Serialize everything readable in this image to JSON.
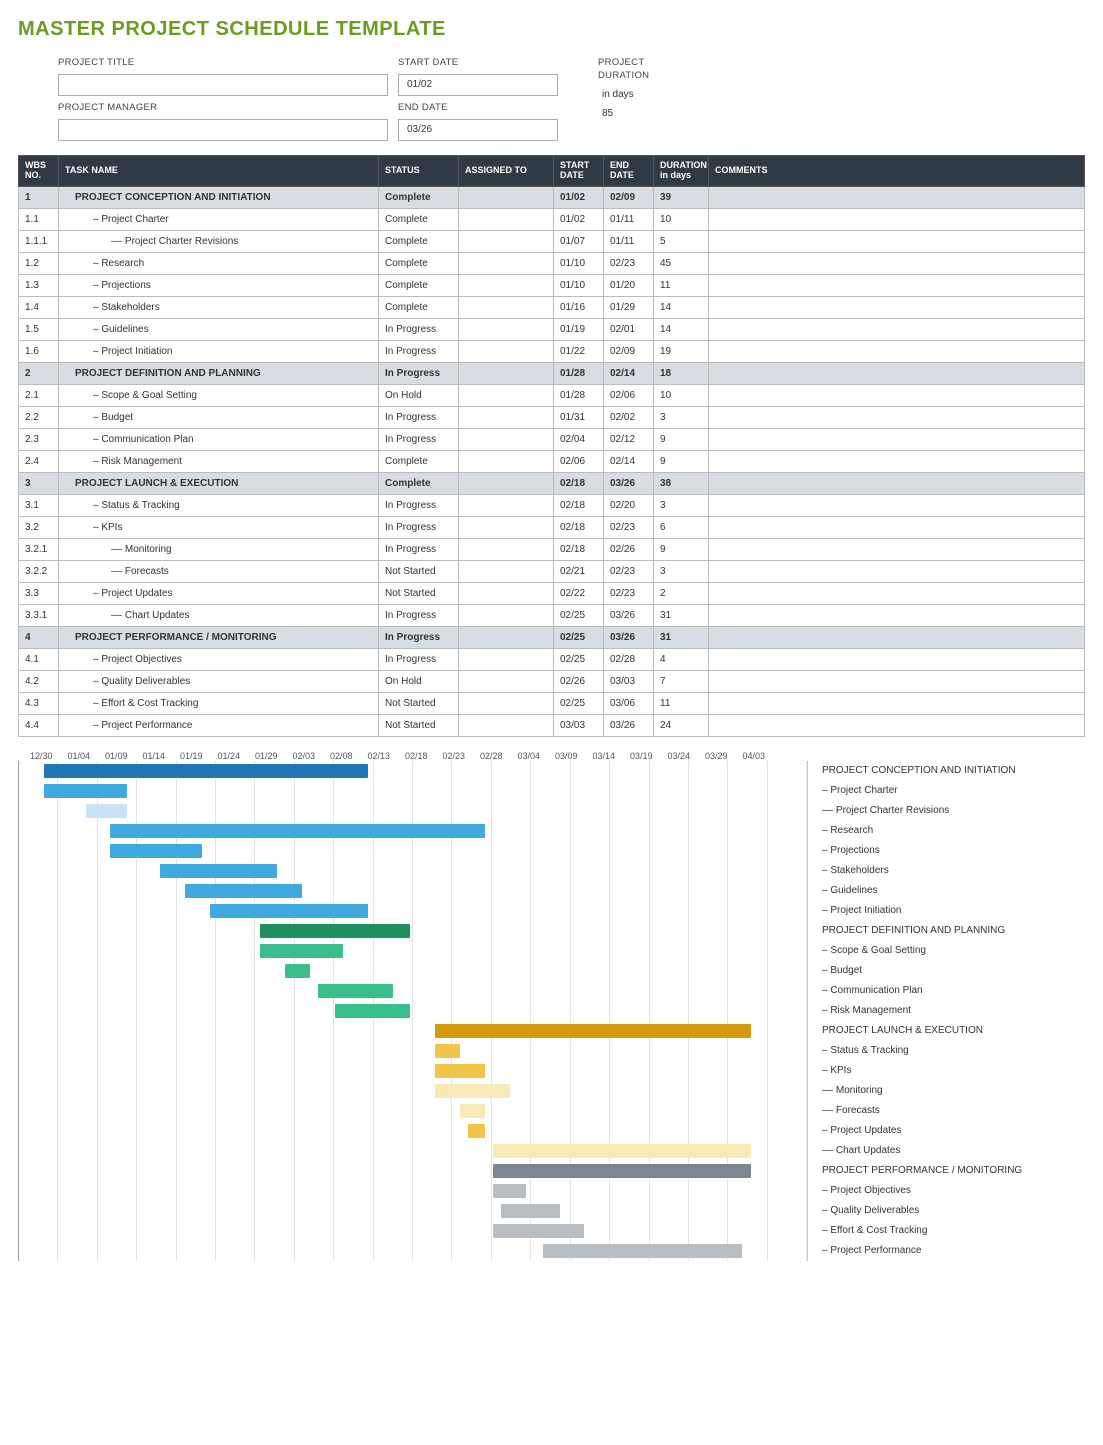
{
  "title": "MASTER PROJECT SCHEDULE TEMPLATE",
  "meta": {
    "project_title_label": "PROJECT TITLE",
    "project_title": "",
    "project_manager_label": "PROJECT MANAGER",
    "project_manager": "",
    "start_date_label": "START DATE",
    "start_date": "01/02",
    "end_date_label": "END DATE",
    "end_date": "03/26",
    "duration_label1": "PROJECT",
    "duration_label2": "DURATION",
    "duration_unit": "in days",
    "duration": "85"
  },
  "columns": {
    "wbs": "WBS NO.",
    "task": "TASK NAME",
    "status": "STATUS",
    "assigned": "ASSIGNED TO",
    "start": "START DATE",
    "end": "END DATE",
    "duration": "DURATION in days",
    "comments": "COMMENTS"
  },
  "rows": [
    {
      "wbs": "1",
      "task": "PROJECT CONCEPTION AND INITIATION",
      "status": "Complete",
      "assigned": "",
      "start": "01/02",
      "end": "02/09",
      "dur": "39",
      "com": "",
      "phase": true
    },
    {
      "wbs": "1.1",
      "task": "– Project Charter",
      "status": "Complete",
      "assigned": "",
      "start": "01/02",
      "end": "01/11",
      "dur": "10",
      "com": ""
    },
    {
      "wbs": "1.1.1",
      "task": "–– Project Charter Revisions",
      "status": "Complete",
      "assigned": "",
      "start": "01/07",
      "end": "01/11",
      "dur": "5",
      "com": ""
    },
    {
      "wbs": "1.2",
      "task": "– Research",
      "status": "Complete",
      "assigned": "",
      "start": "01/10",
      "end": "02/23",
      "dur": "45",
      "com": ""
    },
    {
      "wbs": "1.3",
      "task": "– Projections",
      "status": "Complete",
      "assigned": "",
      "start": "01/10",
      "end": "01/20",
      "dur": "11",
      "com": ""
    },
    {
      "wbs": "1.4",
      "task": "– Stakeholders",
      "status": "Complete",
      "assigned": "",
      "start": "01/16",
      "end": "01/29",
      "dur": "14",
      "com": ""
    },
    {
      "wbs": "1.5",
      "task": "– Guidelines",
      "status": "In Progress",
      "assigned": "",
      "start": "01/19",
      "end": "02/01",
      "dur": "14",
      "com": ""
    },
    {
      "wbs": "1.6",
      "task": "– Project Initiation",
      "status": "In Progress",
      "assigned": "",
      "start": "01/22",
      "end": "02/09",
      "dur": "19",
      "com": ""
    },
    {
      "wbs": "2",
      "task": "PROJECT DEFINITION AND PLANNING",
      "status": "In Progress",
      "assigned": "",
      "start": "01/28",
      "end": "02/14",
      "dur": "18",
      "com": "",
      "phase": true
    },
    {
      "wbs": "2.1",
      "task": "– Scope & Goal Setting",
      "status": "On Hold",
      "assigned": "",
      "start": "01/28",
      "end": "02/06",
      "dur": "10",
      "com": ""
    },
    {
      "wbs": "2.2",
      "task": "– Budget",
      "status": "In Progress",
      "assigned": "",
      "start": "01/31",
      "end": "02/02",
      "dur": "3",
      "com": ""
    },
    {
      "wbs": "2.3",
      "task": "– Communication Plan",
      "status": "In Progress",
      "assigned": "",
      "start": "02/04",
      "end": "02/12",
      "dur": "9",
      "com": ""
    },
    {
      "wbs": "2.4",
      "task": "– Risk Management",
      "status": "Complete",
      "assigned": "",
      "start": "02/06",
      "end": "02/14",
      "dur": "9",
      "com": ""
    },
    {
      "wbs": "3",
      "task": "PROJECT LAUNCH & EXECUTION",
      "status": "Complete",
      "assigned": "",
      "start": "02/18",
      "end": "03/26",
      "dur": "38",
      "com": "",
      "phase": true
    },
    {
      "wbs": "3.1",
      "task": "– Status & Tracking",
      "status": "In Progress",
      "assigned": "",
      "start": "02/18",
      "end": "02/20",
      "dur": "3",
      "com": ""
    },
    {
      "wbs": "3.2",
      "task": "– KPIs",
      "status": "In Progress",
      "assigned": "",
      "start": "02/18",
      "end": "02/23",
      "dur": "6",
      "com": ""
    },
    {
      "wbs": "3.2.1",
      "task": "–– Monitoring",
      "status": "In Progress",
      "assigned": "",
      "start": "02/18",
      "end": "02/26",
      "dur": "9",
      "com": ""
    },
    {
      "wbs": "3.2.2",
      "task": "–– Forecasts",
      "status": "Not Started",
      "assigned": "",
      "start": "02/21",
      "end": "02/23",
      "dur": "3",
      "com": ""
    },
    {
      "wbs": "3.3",
      "task": "– Project Updates",
      "status": "Not Started",
      "assigned": "",
      "start": "02/22",
      "end": "02/23",
      "dur": "2",
      "com": ""
    },
    {
      "wbs": "3.3.1",
      "task": "–– Chart Updates",
      "status": "In Progress",
      "assigned": "",
      "start": "02/25",
      "end": "03/26",
      "dur": "31",
      "com": ""
    },
    {
      "wbs": "4",
      "task": "PROJECT PERFORMANCE / MONITORING",
      "status": "In Progress",
      "assigned": "",
      "start": "02/25",
      "end": "03/26",
      "dur": "31",
      "com": "",
      "phase": true
    },
    {
      "wbs": "4.1",
      "task": "– Project Objectives",
      "status": "In Progress",
      "assigned": "",
      "start": "02/25",
      "end": "02/28",
      "dur": "4",
      "com": ""
    },
    {
      "wbs": "4.2",
      "task": "– Quality Deliverables",
      "status": "On Hold",
      "assigned": "",
      "start": "02/26",
      "end": "03/03",
      "dur": "7",
      "com": ""
    },
    {
      "wbs": "4.3",
      "task": "– Effort & Cost Tracking",
      "status": "Not Started",
      "assigned": "",
      "start": "02/25",
      "end": "03/06",
      "dur": "11",
      "com": ""
    },
    {
      "wbs": "4.4",
      "task": "– Project Performance",
      "status": "Not Started",
      "assigned": "",
      "start": "03/03",
      "end": "03/26",
      "dur": "24",
      "com": ""
    }
  ],
  "chart_data": {
    "type": "bar",
    "orientation": "horizontal-gantt",
    "x_ticks": [
      "12/30",
      "01/04",
      "01/09",
      "01/14",
      "01/19",
      "01/24",
      "01/29",
      "02/03",
      "02/08",
      "02/13",
      "02/18",
      "02/23",
      "02/28",
      "03/04",
      "03/09",
      "03/14",
      "03/19",
      "03/24",
      "03/29",
      "04/03"
    ],
    "x_origin": "12/30",
    "x_unit": "days",
    "tasks": [
      {
        "name": "PROJECT CONCEPTION AND INITIATION",
        "start": 3,
        "dur": 39,
        "color": "c-blue-d"
      },
      {
        "name": "– Project Charter",
        "start": 3,
        "dur": 10,
        "color": "c-blue"
      },
      {
        "name": "–– Project Charter Revisions",
        "start": 8,
        "dur": 5,
        "color": "c-blue-l"
      },
      {
        "name": "– Research",
        "start": 11,
        "dur": 45,
        "color": "c-blue"
      },
      {
        "name": "– Projections",
        "start": 11,
        "dur": 11,
        "color": "c-blue"
      },
      {
        "name": "– Stakeholders",
        "start": 17,
        "dur": 14,
        "color": "c-blue"
      },
      {
        "name": "– Guidelines",
        "start": 20,
        "dur": 14,
        "color": "c-blue"
      },
      {
        "name": "– Project Initiation",
        "start": 23,
        "dur": 19,
        "color": "c-blue"
      },
      {
        "name": "PROJECT DEFINITION AND PLANNING",
        "start": 29,
        "dur": 18,
        "color": "c-green-d"
      },
      {
        "name": "– Scope & Goal Setting",
        "start": 29,
        "dur": 10,
        "color": "c-green"
      },
      {
        "name": "– Budget",
        "start": 32,
        "dur": 3,
        "color": "c-green"
      },
      {
        "name": "– Communication Plan",
        "start": 36,
        "dur": 9,
        "color": "c-green"
      },
      {
        "name": "– Risk Management",
        "start": 38,
        "dur": 9,
        "color": "c-green"
      },
      {
        "name": "PROJECT LAUNCH & EXECUTION",
        "start": 50,
        "dur": 38,
        "color": "c-gold-d"
      },
      {
        "name": "– Status & Tracking",
        "start": 50,
        "dur": 3,
        "color": "c-gold"
      },
      {
        "name": "– KPIs",
        "start": 50,
        "dur": 6,
        "color": "c-gold"
      },
      {
        "name": "–– Monitoring",
        "start": 50,
        "dur": 9,
        "color": "c-gold-l"
      },
      {
        "name": "–– Forecasts",
        "start": 53,
        "dur": 3,
        "color": "c-gold-l"
      },
      {
        "name": "– Project Updates",
        "start": 54,
        "dur": 2,
        "color": "c-gold"
      },
      {
        "name": "–– Chart Updates",
        "start": 57,
        "dur": 31,
        "color": "c-gold-l"
      },
      {
        "name": "PROJECT PERFORMANCE / MONITORING",
        "start": 57,
        "dur": 31,
        "color": "c-gray-d"
      },
      {
        "name": "– Project Objectives",
        "start": 57,
        "dur": 4,
        "color": "c-gray"
      },
      {
        "name": "– Quality Deliverables",
        "start": 58,
        "dur": 7,
        "color": "c-gray"
      },
      {
        "name": "– Effort & Cost Tracking",
        "start": 57,
        "dur": 11,
        "color": "c-gray"
      },
      {
        "name": "– Project Performance",
        "start": 63,
        "dur": 24,
        "color": "c-gray"
      }
    ],
    "total_days": 95
  }
}
